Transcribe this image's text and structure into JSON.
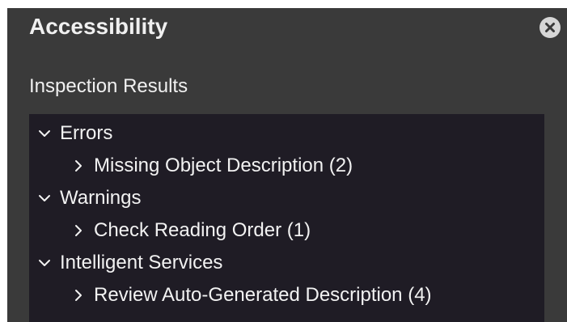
{
  "panel": {
    "title": "Accessibility",
    "close_icon": "close-icon",
    "section_heading": "Inspection Results"
  },
  "results": {
    "groups": [
      {
        "label": "Errors",
        "expanded": true,
        "items": [
          {
            "label": "Missing Object Description (2)",
            "expanded": false
          }
        ]
      },
      {
        "label": "Warnings",
        "expanded": true,
        "items": [
          {
            "label": "Check Reading Order (1)",
            "expanded": false
          }
        ]
      },
      {
        "label": "Intelligent Services",
        "expanded": true,
        "items": [
          {
            "label": "Review Auto-Generated Description (4)",
            "expanded": false
          }
        ]
      }
    ]
  },
  "colors": {
    "panel_background": "#3a3a3a",
    "list_background": "#1f1c25",
    "text": "#f2f2f2"
  }
}
